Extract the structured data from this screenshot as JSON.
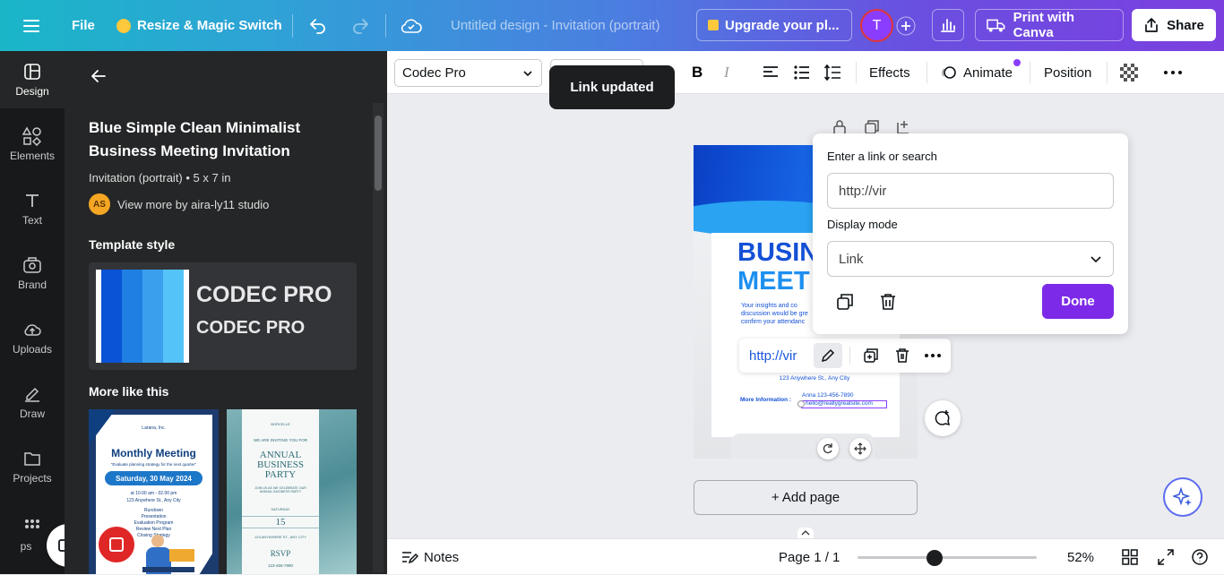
{
  "topbar": {
    "file": "File",
    "resize": "Resize & Magic Switch",
    "doc_title": "Untitled design - Invitation (portrait)",
    "upgrade": "Upgrade your pl...",
    "avatar_letter": "T",
    "print": "Print with Canva",
    "share": "Share"
  },
  "rail": {
    "items": [
      {
        "label": "Design",
        "icon": "design-icon"
      },
      {
        "label": "Elements",
        "icon": "elements-icon"
      },
      {
        "label": "Text",
        "icon": "text-icon"
      },
      {
        "label": "Brand",
        "icon": "brand-icon"
      },
      {
        "label": "Uploads",
        "icon": "uploads-icon"
      },
      {
        "label": "Draw",
        "icon": "draw-icon"
      },
      {
        "label": "Projects",
        "icon": "projects-icon"
      },
      {
        "label": "ps",
        "icon": "apps-icon"
      }
    ]
  },
  "panel": {
    "title": "Blue Simple Clean Minimalist Business Meeting Invitation",
    "subtitle": "Invitation (portrait) • 5 x 7 in",
    "author_initials": "AS",
    "author_link": "View more by aira-ly11 studio",
    "template_style": "Template style",
    "font_big": "CODEC PRO",
    "font_small": "CODEC PRO",
    "swatches": [
      "#ffffff",
      "#0a53d6",
      "#1f7fe3",
      "#3aa0ee",
      "#54c3f7",
      "#ffffff"
    ],
    "more_like": "More like this",
    "thumb1": {
      "org": "Larana, Inc.",
      "title": "Monthly Meeting",
      "quote": "\"Evaluate planning strategy for the next quarter\"",
      "date": "Saturday, 30 May 2024",
      "time": "at 10.00 am - 02.00 pm",
      "place": "123 Anywhere St., Any City",
      "agenda": [
        "Rundown",
        "Presentation",
        "Evaluation Program",
        "Review Next Plan",
        "Closing Strategy"
      ]
    },
    "thumb2": {
      "org": "BORCELLE",
      "invite": "WE ARE INVITING YOU FOR",
      "title_l1": "ANNUAL",
      "title_l2": "BUSINESS",
      "title_l3": "PARTY",
      "desc": "JOIN US AS WE CELEBRATE OUR ANNUAL BUSINESS PARTY",
      "month": "SATURDAY",
      "day": "15",
      "address": "123 ANYWHERE ST., ANY CITY",
      "rsvp": "RSVP",
      "contact": "123-456-7890"
    }
  },
  "editor_toolbar": {
    "font": "Codec Pro",
    "effects": "Effects",
    "animate": "Animate",
    "position": "Position",
    "toast": "Link updated"
  },
  "canvas": {
    "headline_l1": "BUSIN",
    "headline_l2": "MEET",
    "body_l1": "Your insights and co",
    "body_l2": "discussion would be gre",
    "body_l3": "confirm your attendanc",
    "address": "123 Anywhere St., Any City",
    "more_info": "More Information :",
    "phone": "Anna 123-456-7890",
    "email": "hello@reallygreatsite.com",
    "link_chip": "http://vir",
    "add_page": "+ Add page"
  },
  "link_popup": {
    "label": "Enter a link or search",
    "value": "http://vir",
    "display_label": "Display mode",
    "display_value": "Link",
    "done": "Done"
  },
  "footer": {
    "notes": "Notes",
    "page": "Page 1 / 1",
    "zoom": "52%",
    "zoom_level": 0.43
  }
}
